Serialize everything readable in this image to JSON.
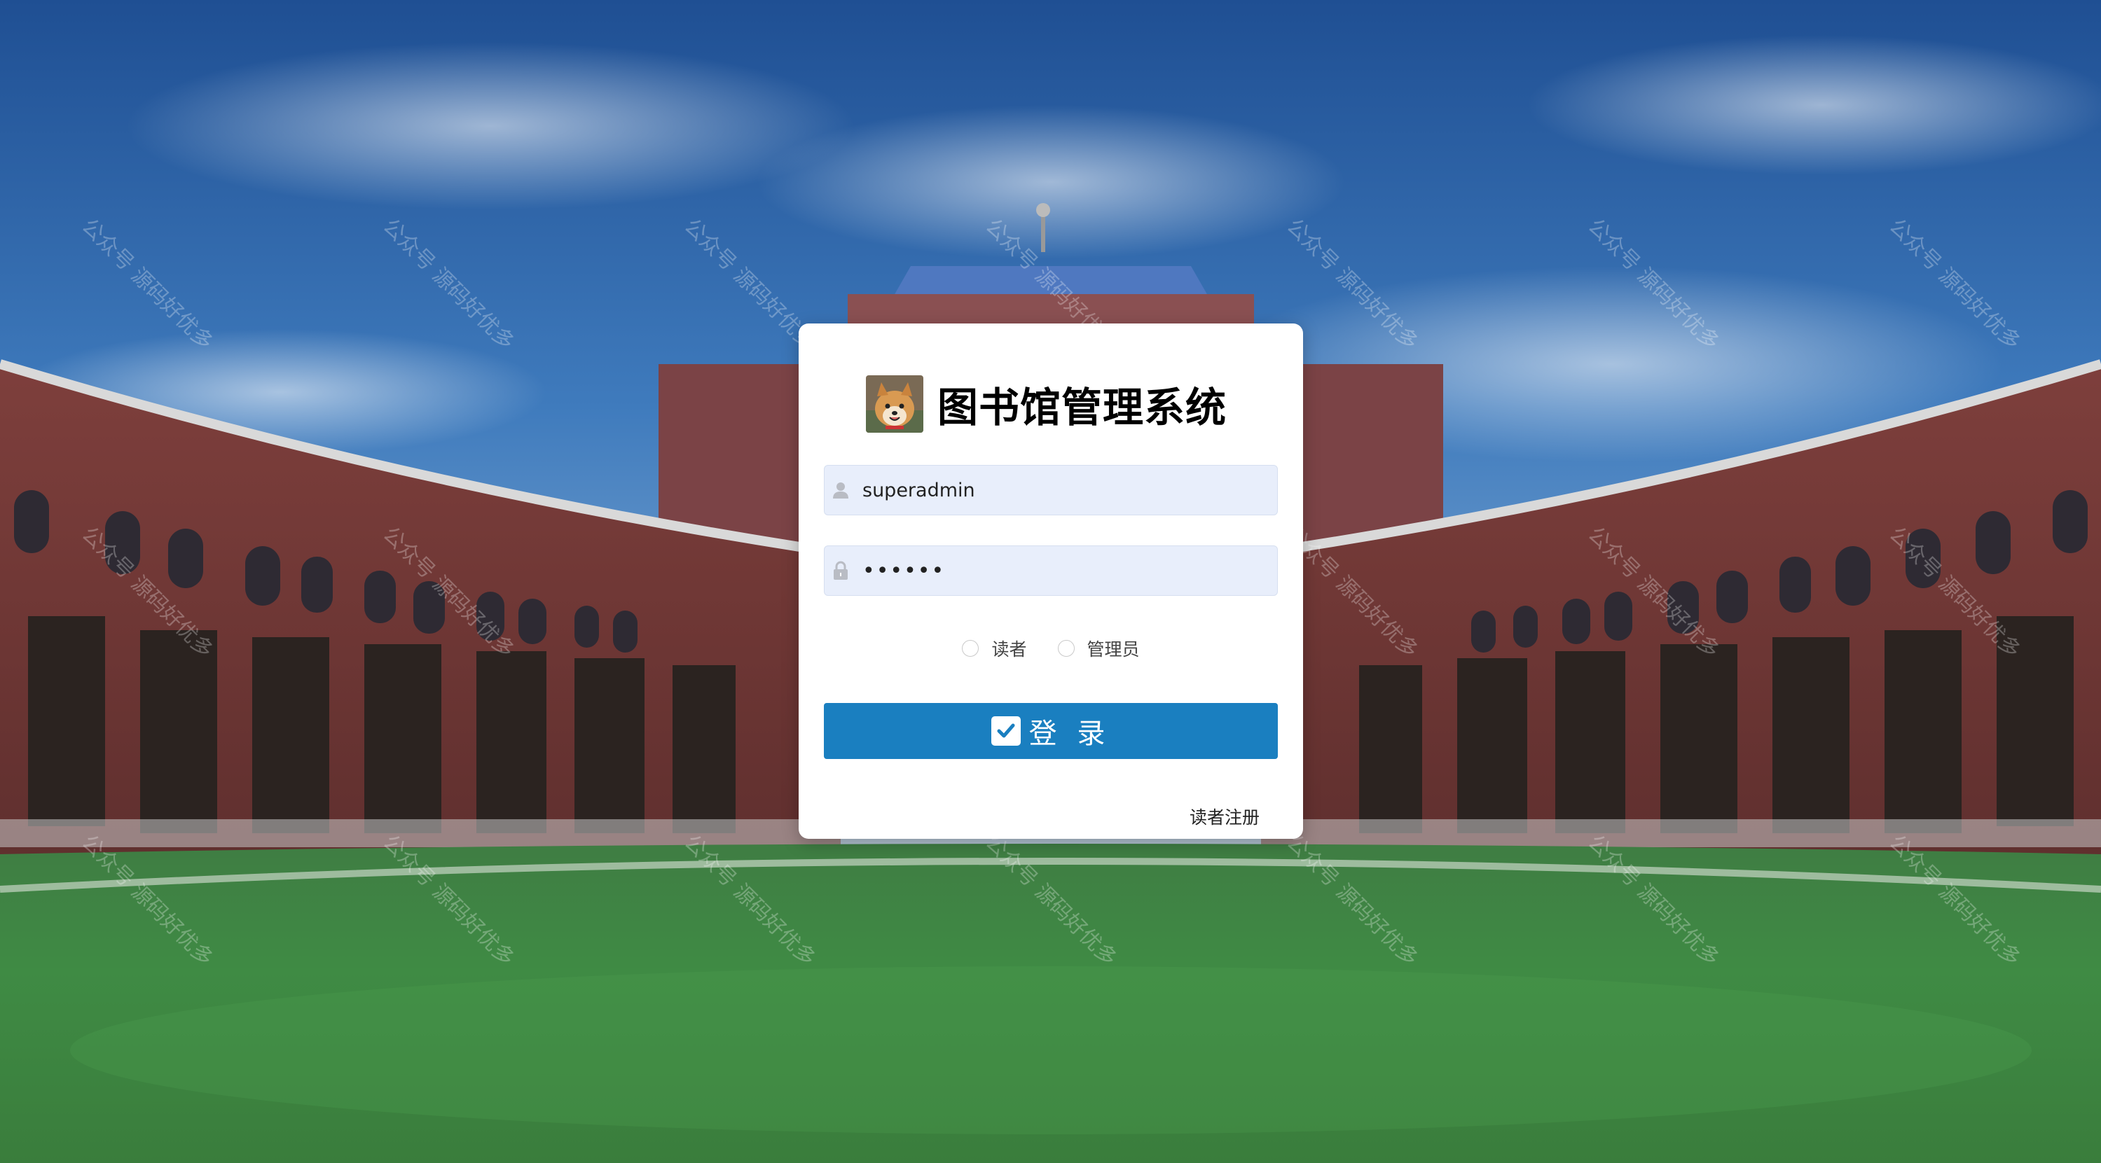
{
  "app": {
    "title": "图书馆管理系统"
  },
  "login_form": {
    "username_value": "superadmin",
    "password_value": "••••••",
    "roles": [
      {
        "label": "读者",
        "selected": false
      },
      {
        "label": "管理员",
        "selected": false
      }
    ],
    "login_button_label": "登 录",
    "register_link_label": "读者注册"
  },
  "watermark": {
    "text": "公众号 源码好优多"
  },
  "icons": {
    "username": "user-icon",
    "password": "lock-icon",
    "login": "checkbox-check-icon",
    "logo": "shiba-dog-avatar"
  },
  "colors": {
    "primary_button": "#1a7fc0",
    "input_background": "#e8eefb",
    "card_background": "#ffffff"
  }
}
